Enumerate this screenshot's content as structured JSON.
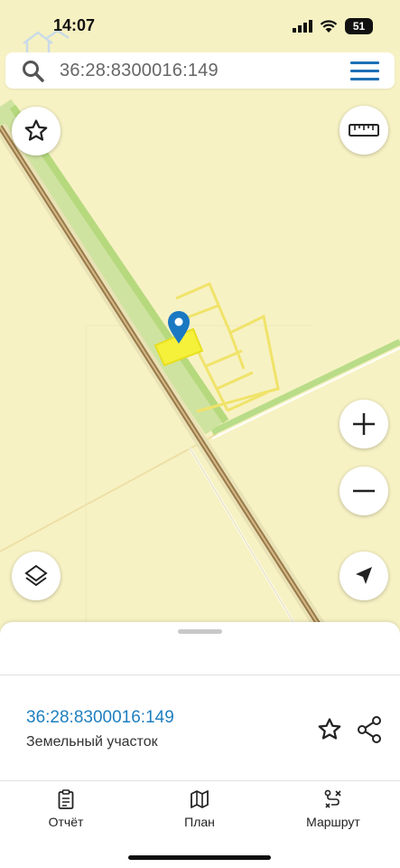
{
  "status_bar": {
    "time": "14:07",
    "battery": "51"
  },
  "search": {
    "query": "36:28:8300016:149"
  },
  "map": {
    "buttons": [
      "favorite",
      "ruler",
      "zoom-in",
      "zoom-out",
      "layers",
      "locate"
    ],
    "colors": {
      "land": "#f7f2c4",
      "highlight": "#f5f03a",
      "railway": "#9a7a4a",
      "marker": "#1a78c2"
    }
  },
  "parcel": {
    "cadastral_number": "36:28:8300016:149",
    "type": "Земельный участок"
  },
  "tabs": [
    {
      "label": "Отчёт",
      "icon": "clipboard-icon"
    },
    {
      "label": "План",
      "icon": "map-icon"
    },
    {
      "label": "Маршрут",
      "icon": "route-icon"
    }
  ],
  "colors": {
    "accent": "#1e7fbf",
    "menu": "#1d6fb6"
  }
}
